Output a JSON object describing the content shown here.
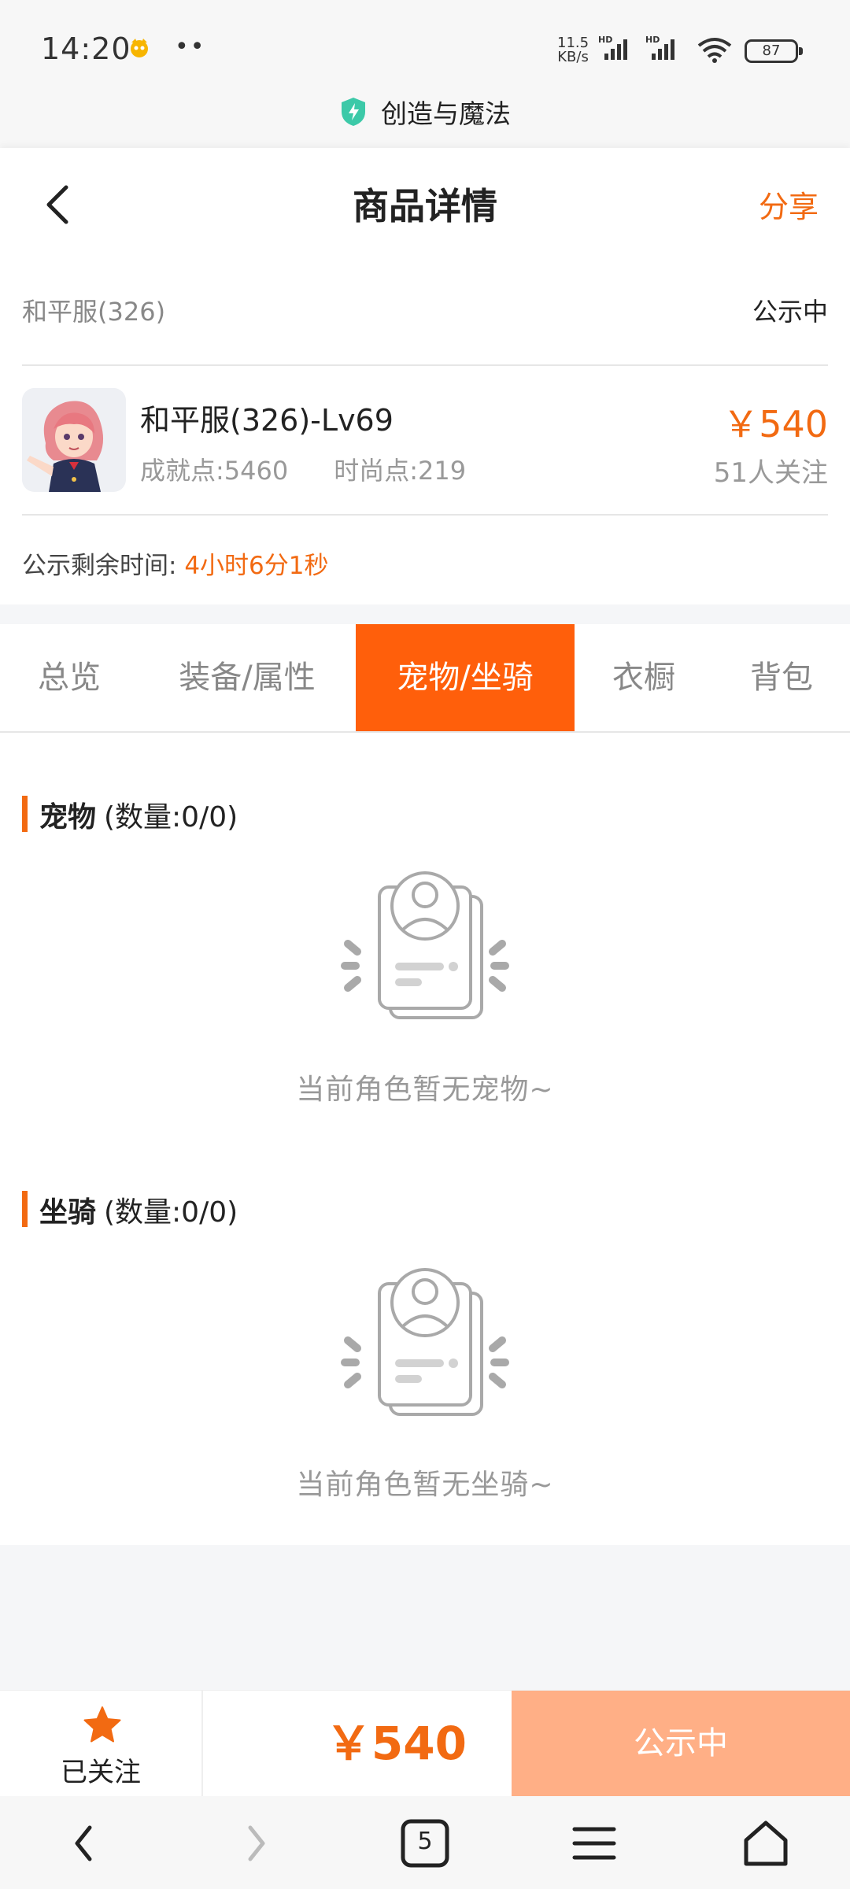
{
  "status_bar": {
    "time": "14:20",
    "dots": "••",
    "net_speed_value": "11.5",
    "net_speed_unit": "KB/s",
    "battery": "87"
  },
  "app_bar": {
    "game_name": "创造与魔法"
  },
  "header": {
    "title": "商品详情",
    "share": "分享"
  },
  "item": {
    "server": "和平服(326)",
    "status": "公示中",
    "name": "和平服(326)-Lv69",
    "achievement_points": "成就点:5460",
    "fashion_points": "时尚点:219",
    "price": "￥540",
    "followers": "51人关注",
    "remaining_label": "公示剩余时间:",
    "remaining_value": "4小时6分1秒"
  },
  "tabs": [
    {
      "label": "总览"
    },
    {
      "label": "装备/属性"
    },
    {
      "label": "宠物/坐骑"
    },
    {
      "label": "衣橱"
    },
    {
      "label": "背包"
    }
  ],
  "sections": {
    "pets": {
      "title": "宠物",
      "count": "(数量:0/0)",
      "empty": "当前角色暂无宠物~"
    },
    "mounts": {
      "title": "坐骑",
      "count": "(数量:0/0)",
      "empty": "当前角色暂无坐骑~"
    }
  },
  "bottom": {
    "follow_label": "已关注",
    "price": "￥540",
    "action": "公示中"
  },
  "system_nav": {
    "tab_count": "5"
  },
  "colors": {
    "accent": "#f26a12",
    "active_tab": "#ff5f0b",
    "disabled_button": "#ffaf86"
  }
}
